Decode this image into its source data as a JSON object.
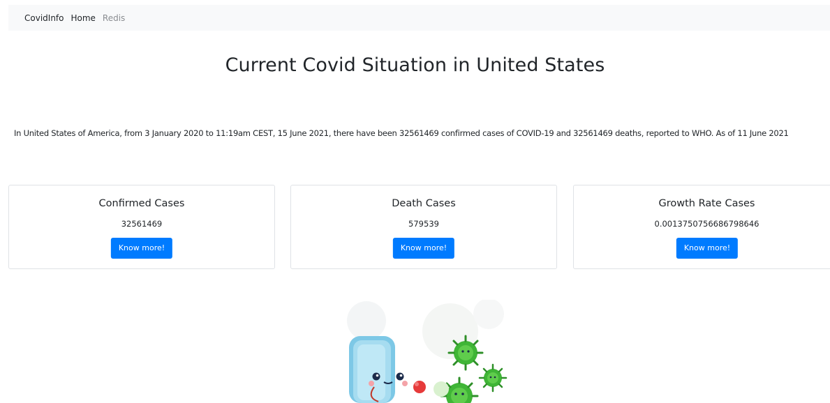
{
  "navbar": {
    "brand": "CovidInfo",
    "links": [
      {
        "label": "Home",
        "state": "active"
      },
      {
        "label": "Redis",
        "state": "muted"
      }
    ]
  },
  "page": {
    "title": "Current Covid Situation in United States",
    "summary": "In United States of America, from 3 January 2020 to 11:19am CEST, 15 June 2021, there have been 32561469 confirmed cases of COVID-19 and 32561469 deaths, reported to WHO. As of 11 June 2021"
  },
  "cards": [
    {
      "title": "Confirmed Cases",
      "value": "32561469",
      "button": "Know more!"
    },
    {
      "title": "Death Cases",
      "value": "579539",
      "button": "Know more!"
    },
    {
      "title": "Growth Rate Cases",
      "value": "0.0013750756686798646",
      "button": "Know more!"
    }
  ],
  "colors": {
    "primary": "#007bff",
    "navbar_bg": "#f8f9fa",
    "virus_green": "#3fb536",
    "mask_blue": "#7dc8e6",
    "glove_red": "#e63a3a"
  },
  "illustration": {
    "icon": "cartoon-mask-fighting-virus-illustration"
  }
}
